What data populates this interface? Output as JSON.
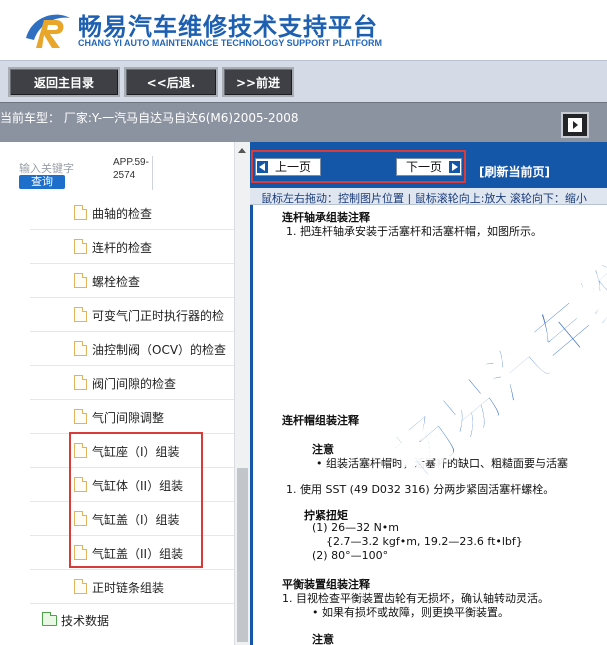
{
  "header": {
    "title_cn": "畅易汽车维修技术支持平台",
    "title_en": "CHANG YI AUTO MAINTENANCE TECHNOLOGY SUPPORT PLATFORM"
  },
  "toolbar": {
    "home_label": "返回主目录",
    "back_label": "<<后退.",
    "forward_label": ">>前进"
  },
  "vehicle": {
    "text": "当前车型：  厂家:Y-一汽马自达马自达6(M6)2005-2008"
  },
  "sidebar": {
    "keyword_placeholder": "输入关键字",
    "query_label": "查询",
    "app_code": "APP.59-2574",
    "items": [
      {
        "label": "曲轴的检查"
      },
      {
        "label": "连杆的检查"
      },
      {
        "label": "螺栓检查"
      },
      {
        "label": "可变气门正时执行器的检"
      },
      {
        "label": "油控制阀（OCV）的检查"
      },
      {
        "label": "阀门间隙的检查"
      },
      {
        "label": "气门间隙调整"
      },
      {
        "label": "气缸座（I）组装"
      },
      {
        "label": "气缸体（II）组装"
      },
      {
        "label": "气缸盖（I）组装"
      },
      {
        "label": "气缸盖（II）组装"
      },
      {
        "label": "正时链条组装"
      }
    ],
    "folder": {
      "label": "技术数据"
    }
  },
  "viewer": {
    "prev_label": "上一页",
    "next_label": "下一页",
    "refresh_label": "[刷新当前页]",
    "hint": "鼠标左右拖动：控制图片位置 | 鼠标滚轮向上:放大  滚轮向下：缩小",
    "doc_lines": [
      {
        "text": "连杆轴承组装注释",
        "bold": true
      },
      {
        "text": "1. 把连杆轴承安装于活塞杆和活塞杆帽，如图所示。",
        "bold": false
      },
      {
        "text": "连杆帽组装注释",
        "bold": true
      },
      {
        "text": "注意",
        "bold": true
      },
      {
        "text": "• 组装活塞杆帽时，活塞杆的缺口、粗糙面要与活塞",
        "bold": false
      },
      {
        "text": "1. 使用 SST (49 D032 316) 分两步紧固活塞杆螺栓。",
        "bold": false
      },
      {
        "text": "拧紧扭矩",
        "bold": true
      },
      {
        "text": "(1) 26—32 N•m",
        "bold": false
      },
      {
        "text": "{2.7—3.2 kgf•m, 19.2—23.6 ft•lbf}",
        "bold": false
      },
      {
        "text": "(2) 80°—100°",
        "bold": false
      },
      {
        "text": "平衡装置组装注释",
        "bold": true
      },
      {
        "text": "1. 目视检查平衡装置齿轮有无损坏，确认轴转动灵活。",
        "bold": false
      },
      {
        "text": "• 如果有损坏或故障，则更换平衡装置。",
        "bold": false
      },
      {
        "text": "注意",
        "bold": true
      }
    ],
    "watermark": "畅易汽车维"
  }
}
